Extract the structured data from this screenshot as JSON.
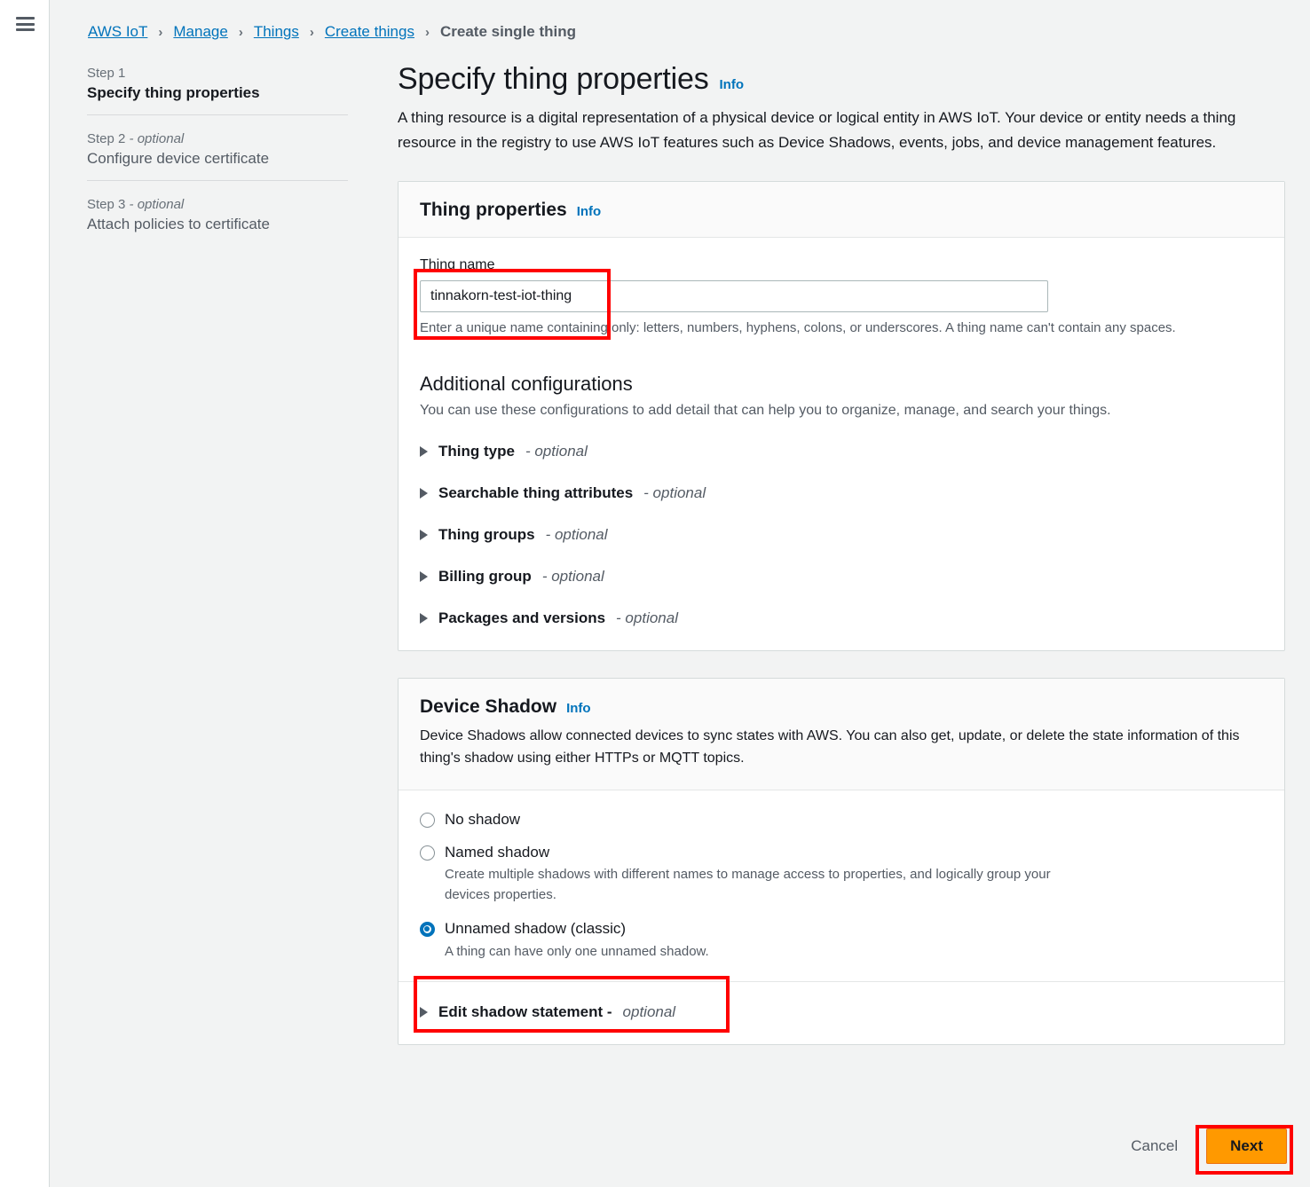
{
  "rail": {
    "menu_icon": "hamburger-menu-icon"
  },
  "breadcrumb": {
    "items": [
      {
        "label": "AWS IoT",
        "link": true
      },
      {
        "label": "Manage",
        "link": true
      },
      {
        "label": "Things",
        "link": true
      },
      {
        "label": "Create things",
        "link": true
      },
      {
        "label": "Create single thing",
        "link": false
      }
    ],
    "separator": "›"
  },
  "stepper": {
    "steps": [
      {
        "kicker": "Step 1",
        "optional": "",
        "title": "Specify thing properties",
        "active": true
      },
      {
        "kicker": "Step 2",
        "optional": " - optional",
        "title": "Configure device certificate",
        "active": false
      },
      {
        "kicker": "Step 3",
        "optional": " - optional",
        "title": "Attach policies to certificate",
        "active": false
      }
    ]
  },
  "page": {
    "title": "Specify thing properties",
    "info_label": "Info",
    "description": "A thing resource is a digital representation of a physical device or logical entity in AWS IoT. Your device or entity needs a thing resource in the registry to use AWS IoT features such as Device Shadows, events, jobs, and device management features."
  },
  "thing_properties": {
    "title": "Thing properties",
    "info_label": "Info",
    "thing_name": {
      "label": "Thing name",
      "value": "tinnakorn-test-iot-thing",
      "placeholder": "",
      "hint": "Enter a unique name containing only: letters, numbers, hyphens, colons, or underscores. A thing name can't contain any spaces."
    },
    "additional": {
      "heading": "Additional configurations",
      "description": "You can use these configurations to add detail that can help you to organize, manage, and search your things.",
      "expanders": [
        {
          "label": "Thing type",
          "optional": "- optional",
          "expanded": false
        },
        {
          "label": "Searchable thing attributes",
          "optional": "- optional",
          "expanded": false
        },
        {
          "label": "Thing groups",
          "optional": "- optional",
          "expanded": false
        },
        {
          "label": "Billing group",
          "optional": "- optional",
          "expanded": false
        },
        {
          "label": "Packages and versions",
          "optional": "- optional",
          "expanded": false
        }
      ]
    }
  },
  "device_shadow": {
    "title": "Device Shadow",
    "info_label": "Info",
    "description": "Device Shadows allow connected devices to sync states with AWS. You can also get, update, or delete the state information of this thing's shadow using either HTTPs or MQTT topics.",
    "options": [
      {
        "label": "No shadow",
        "sub": "",
        "selected": false
      },
      {
        "label": "Named shadow",
        "sub": "Create multiple shadows with different names to manage access to properties, and logically group your devices properties.",
        "selected": false
      },
      {
        "label": "Unnamed shadow (classic)",
        "sub": "A thing can have only one unnamed shadow.",
        "selected": true
      }
    ],
    "edit_statement": {
      "label": "Edit shadow statement -",
      "optional": "optional",
      "expanded": false
    }
  },
  "actions": {
    "cancel_label": "Cancel",
    "next_label": "Next"
  },
  "colors": {
    "accent_blue": "#0073bb",
    "primary_orange": "#ff9900",
    "annotation_red": "#ff0000",
    "page_bg": "#f2f3f3"
  }
}
